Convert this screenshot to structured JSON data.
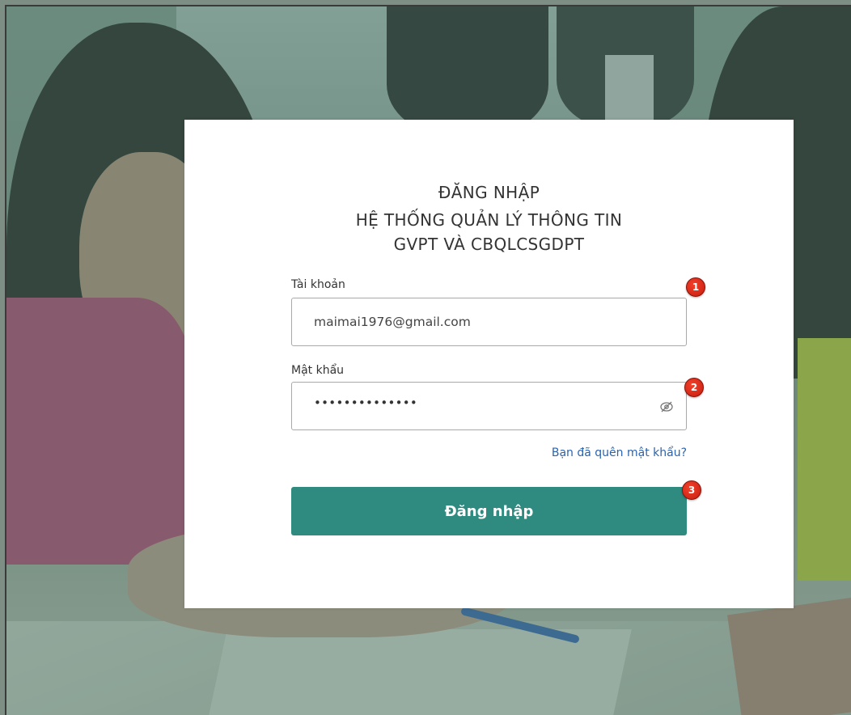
{
  "login": {
    "heading_line1": "ĐĂNG NHẬP",
    "heading_line2": "HỆ THỐNG QUẢN LÝ THÔNG TIN",
    "heading_line3": "GVPT VÀ CBQLCSGDPT",
    "username": {
      "label": "Tài khoản",
      "value": "maimai1976@gmail.com"
    },
    "password": {
      "label": "Mật khẩu",
      "masked_value": "••••••••••••••",
      "toggle_icon": "eye-slash-icon"
    },
    "forgot_link": "Bạn đã quên mật khẩu?",
    "submit_label": "Đăng nhập"
  },
  "markers": [
    "1",
    "2",
    "3"
  ],
  "colors": {
    "primary_button": "#2f8a80",
    "link": "#2b63ad",
    "marker": "#e0291b",
    "background_overlay": "#406e60"
  }
}
